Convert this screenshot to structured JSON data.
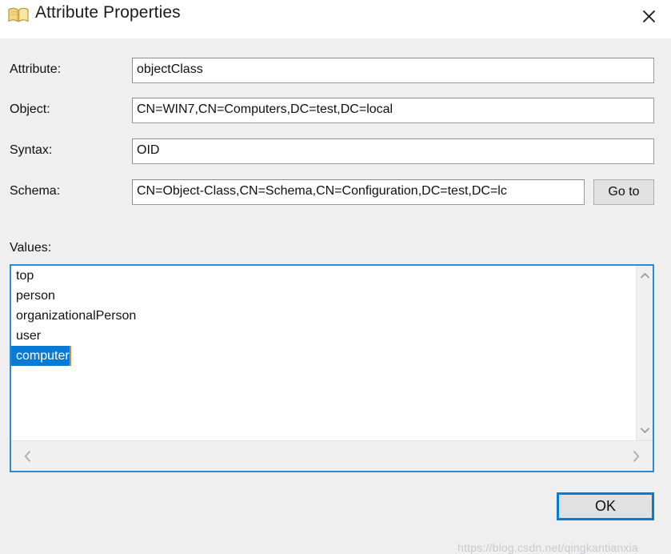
{
  "window": {
    "title": "Attribute Properties",
    "icon": "book-icon",
    "close_icon": "close-icon"
  },
  "fields": [
    {
      "label": "Attribute:",
      "value": "objectClass",
      "name": "attribute"
    },
    {
      "label": "Object:",
      "value": "CN=WIN7,CN=Computers,DC=test,DC=local",
      "name": "object"
    },
    {
      "label": "Syntax:",
      "value": "OID",
      "name": "syntax"
    },
    {
      "label": "Schema:",
      "value": "CN=Object-Class,CN=Schema,CN=Configuration,DC=test,DC=lc",
      "name": "schema"
    }
  ],
  "goto_button": {
    "label": "Go to"
  },
  "values": {
    "label": "Values:",
    "items": [
      {
        "text": "top",
        "selected": false
      },
      {
        "text": "person",
        "selected": false
      },
      {
        "text": "organizationalPerson",
        "selected": false
      },
      {
        "text": "user",
        "selected": false
      },
      {
        "text": "computer",
        "selected": true
      }
    ],
    "selection_color": "#0a7bd4",
    "border_color": "#2a8ad4",
    "scrollbar": {
      "up_icon": "chevron-up-icon",
      "down_icon": "chevron-down-icon",
      "left_icon": "chevron-left-icon",
      "right_icon": "chevron-right-icon"
    }
  },
  "ok_button": {
    "label": "OK",
    "focus_color": "#0a7bd4"
  },
  "watermark": {
    "text": "https://blog.csdn.net/qingkantianxia"
  }
}
